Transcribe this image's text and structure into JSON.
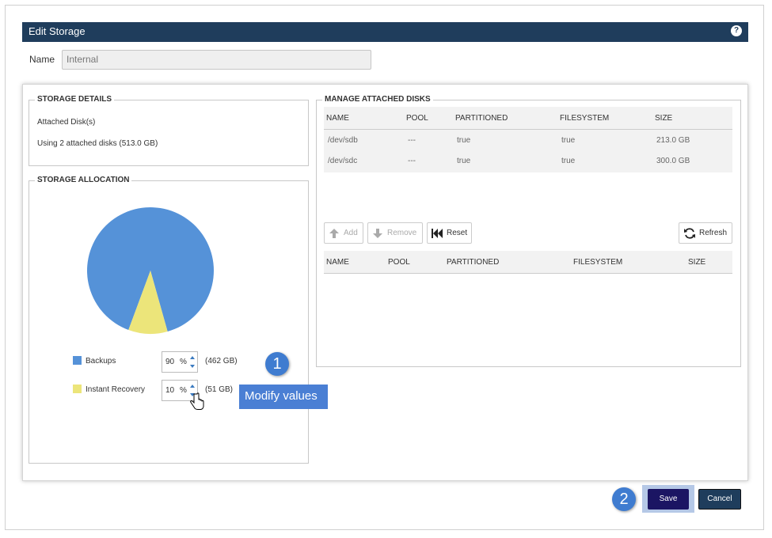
{
  "dialog": {
    "title": "Edit Storage"
  },
  "name_field": {
    "label": "Name",
    "value": "Internal"
  },
  "storage_details": {
    "legend": "STORAGE DETAILS",
    "line1": "Attached Disk(s)",
    "line2": "Using 2 attached disks (513.0 GB)"
  },
  "storage_allocation": {
    "legend": "STORAGE ALLOCATION",
    "items": [
      {
        "label": "Backups",
        "value": "90",
        "unit": "%",
        "size": "(462 GB)",
        "color": "#5592d8"
      },
      {
        "label": "Instant Recovery",
        "value": "10",
        "unit": "%",
        "size": "(51 GB)",
        "color": "#ece57a"
      }
    ]
  },
  "manage_disks": {
    "legend": "MANAGE ATTACHED DISKS",
    "columns": [
      "NAME",
      "POOL",
      "PARTITIONED",
      "FILESYSTEM",
      "SIZE"
    ],
    "rows": [
      [
        "/dev/sdb",
        "---",
        "true",
        "true",
        "213.0 GB"
      ],
      [
        "/dev/sdc",
        "---",
        "true",
        "true",
        "300.0 GB"
      ]
    ],
    "buttons": {
      "add": "Add",
      "remove": "Remove",
      "reset": "Reset",
      "refresh": "Refresh"
    },
    "lower_columns": [
      "NAME",
      "POOL",
      "PARTITIONED",
      "FILESYSTEM",
      "SIZE"
    ]
  },
  "annotations": {
    "step1": "1",
    "step1_tip": "Modify values",
    "step2": "2"
  },
  "footer": {
    "save": "Save",
    "cancel": "Cancel"
  }
}
